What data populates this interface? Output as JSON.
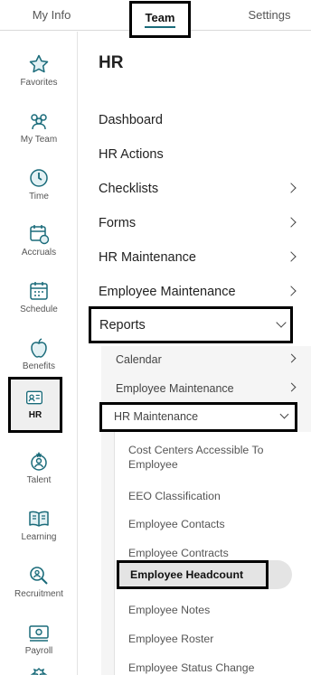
{
  "tabs": [
    {
      "label": "My Info",
      "active": false
    },
    {
      "label": "Team",
      "active": true
    },
    {
      "label": "Settings",
      "active": false
    }
  ],
  "rail": {
    "items": [
      {
        "label": "Favorites",
        "icon": "star-icon"
      },
      {
        "label": "My Team",
        "icon": "people-icon"
      },
      {
        "label": "Time",
        "icon": "clock-icon"
      },
      {
        "label": "Accruals",
        "icon": "calendar-clock-icon"
      },
      {
        "label": "Schedule",
        "icon": "calendar-icon"
      },
      {
        "label": "Benefits",
        "icon": "apple-icon"
      },
      {
        "label": "HR",
        "icon": "id-card-icon",
        "active": true
      },
      {
        "label": "Talent",
        "icon": "person-award-icon"
      },
      {
        "label": "Learning",
        "icon": "book-icon"
      },
      {
        "label": "Recruitment",
        "icon": "search-person-icon"
      },
      {
        "label": "Payroll",
        "icon": "money-icon"
      }
    ],
    "accent_color": "#1a6b7a"
  },
  "panel": {
    "title": "HR",
    "items": [
      {
        "label": "Dashboard"
      },
      {
        "label": "HR Actions"
      },
      {
        "label": "Checklists"
      },
      {
        "label": "Forms"
      },
      {
        "label": "HR Maintenance"
      },
      {
        "label": "Employee Maintenance"
      },
      {
        "label": "Reports",
        "expanded": true
      }
    ],
    "reports_sub": [
      {
        "label": "Calendar"
      },
      {
        "label": "Employee Maintenance"
      },
      {
        "label": "HR Maintenance",
        "expanded": true
      }
    ],
    "hr_maintenance_reports": [
      {
        "label": "Cost Centers Accessible To Employee"
      },
      {
        "label": "EEO Classification"
      },
      {
        "label": "Employee Contacts"
      },
      {
        "label": "Employee Contracts"
      },
      {
        "label": "Employee Headcount",
        "selected": true
      },
      {
        "label": "Employee Notes"
      },
      {
        "label": "Employee Roster"
      },
      {
        "label": "Employee Status Change"
      }
    ]
  }
}
